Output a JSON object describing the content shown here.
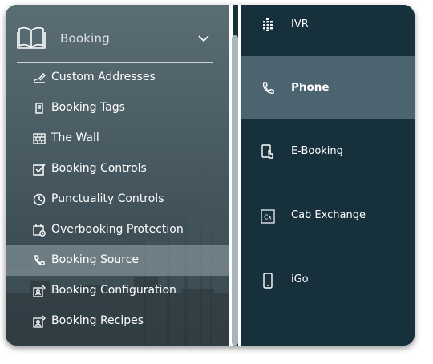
{
  "left_panel": {
    "header": {
      "title": "Booking"
    },
    "items": [
      {
        "label": "Custom Addresses",
        "icon": "signature-icon"
      },
      {
        "label": "Booking Tags",
        "icon": "tag-icon"
      },
      {
        "label": "The Wall",
        "icon": "brick-wall-icon"
      },
      {
        "label": "Booking Controls",
        "icon": "checkbox-icon"
      },
      {
        "label": "Punctuality Controls",
        "icon": "clock-icon"
      },
      {
        "label": "Overbooking Protection",
        "icon": "calendar-clock-icon"
      },
      {
        "label": "Booking Source",
        "icon": "phone-icon",
        "active": true
      },
      {
        "label": "Booking Configuration",
        "icon": "contact-card-icon"
      },
      {
        "label": "Booking Recipes",
        "icon": "contact-card-icon"
      }
    ]
  },
  "right_panel": {
    "items": [
      {
        "label": "IVR",
        "icon": "ivr-icon"
      },
      {
        "label": "Phone",
        "icon": "phone-icon",
        "active": true
      },
      {
        "label": "E-Booking",
        "icon": "tablet-touch-icon"
      },
      {
        "label": "Cab Exchange",
        "icon": "cab-exchange-icon"
      },
      {
        "label": "iGo",
        "icon": "mobile-icon"
      }
    ]
  },
  "colors": {
    "right_bg": "#17313c",
    "right_active": "#4b6470",
    "left_active": "#96a5ac"
  }
}
